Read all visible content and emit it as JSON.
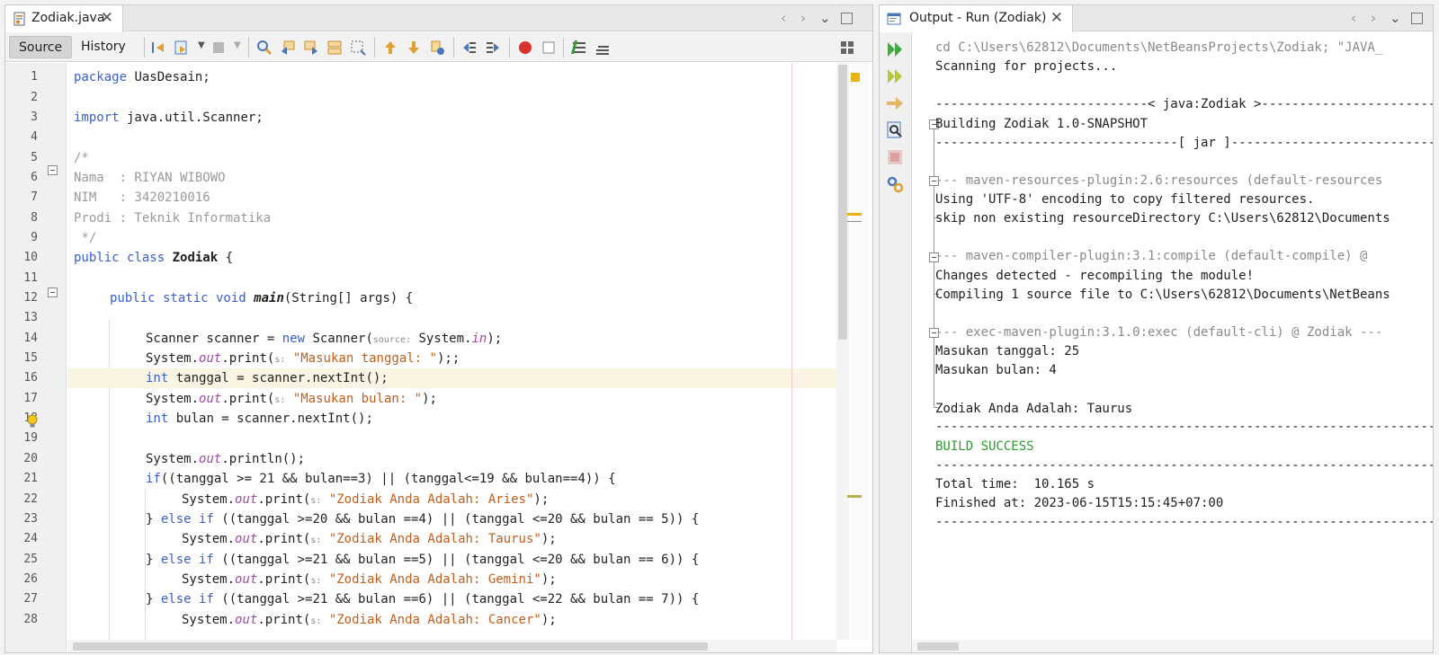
{
  "editor": {
    "tab_title": "Zodiak.java",
    "tab_close": "✕",
    "toolbar": {
      "source_label": "Source",
      "history_label": "History"
    },
    "line_numbers": [
      "1",
      "2",
      "3",
      "4",
      "5",
      "6",
      "7",
      "8",
      "9",
      "10",
      "11",
      "12",
      "13",
      "14",
      "15",
      "16",
      "17",
      "18",
      "19",
      "20",
      "21",
      "22",
      "23",
      "24",
      "25",
      "26",
      "27",
      "28"
    ],
    "code": {
      "l1_kw": "package",
      "l1_rest": " UasDesain;",
      "l3_kw": "import",
      "l3_rest": " java.util.Scanner;",
      "l5": "/*",
      "l6": "Nama  : RIYAN WIBOWO",
      "l7": "NIM   : 3420210016",
      "l8": "Prodi : Teknik Informatika",
      "l9": " */",
      "l10_kw": "public class",
      "l10_name": "Zodiak",
      "l10_rest": " {",
      "l12_kw": "public static void",
      "l12_name": "main",
      "l12_rest": "(String[] args) {",
      "l14_a": "Scanner scanner = ",
      "l14_kw": "new",
      "l14_b": " Scanner(",
      "l14_hint": "source:",
      "l14_c": " System.",
      "l14_fld": "in",
      "l14_d": ");",
      "l15_a": "System.",
      "l15_fld": "out",
      "l15_b": ".print(",
      "l15_hint": "s:",
      "l15_str": "\"Masukan tanggal: \"",
      "l15_c": ");;",
      "l16_kw": "int",
      "l16_rest": " tanggal = scanner.nextInt();",
      "l17_a": "System.",
      "l17_fld": "out",
      "l17_b": ".print(",
      "l17_hint": "s:",
      "l17_str": "\"Masukan bulan: \"",
      "l17_c": ");",
      "l18_kw": "int",
      "l18_rest": " bulan = scanner.nextInt();",
      "l20_a": "System.",
      "l20_fld": "out",
      "l20_b": ".println();",
      "l21_kw": "if",
      "l21_rest": "((tanggal >= 21 && bulan==3) || (tanggal<=19 && bulan==4)) {",
      "l22_a": "System.",
      "l22_fld": "out",
      "l22_b": ".print(",
      "l22_hint": "s:",
      "l22_str": "\"Zodiak Anda Adalah: Aries\"",
      "l22_c": ");",
      "l23_a": "} ",
      "l23_kw": "else if",
      "l23_rest": " ((tanggal >=20 && bulan ==4) || (tanggal <=20 && bulan == 5)) {",
      "l24_a": "System.",
      "l24_fld": "out",
      "l24_b": ".print(",
      "l24_hint": "s:",
      "l24_str": "\"Zodiak Anda Adalah: Taurus\"",
      "l24_c": ");",
      "l25_a": "} ",
      "l25_kw": "else if",
      "l25_rest": " ((tanggal >=21 && bulan ==5) || (tanggal <=20 && bulan == 6)) {",
      "l26_a": "System.",
      "l26_fld": "out",
      "l26_b": ".print(",
      "l26_hint": "s:",
      "l26_str": "\"Zodiak Anda Adalah: Gemini\"",
      "l26_c": ");",
      "l27_a": "} ",
      "l27_kw": "else if",
      "l27_rest": " ((tanggal >=21 && bulan ==6) || (tanggal <=22 && bulan == 7)) {",
      "l28_a": "System.",
      "l28_fld": "out",
      "l28_b": ".print(",
      "l28_hint": "s:",
      "l28_str": "\"Zodiak Anda Adalah: Cancer\"",
      "l28_c": ");"
    }
  },
  "output": {
    "tab_title": "Output - Run (Zodiak)",
    "tab_close": "✕",
    "lines": {
      "cmd": "cd C:\\Users\\62812\\Documents\\NetBeansProjects\\Zodiak; \"JAVA_",
      "scanning": "Scanning for projects...",
      "sep_java": "----------------------------< java:Zodiak >--------------------------",
      "building": "Building Zodiak 1.0-SNAPSHOT",
      "sep_jar": "--------------------------------[ jar ]-----------------------------",
      "resources": "--- maven-resources-plugin:2.6:resources (default-resources",
      "utf8": "Using 'UTF-8' encoding to copy filtered resources.",
      "skip": "skip non existing resourceDirectory C:\\Users\\62812\\Documents",
      "compiler": "--- maven-compiler-plugin:3.1:compile (default-compile) @",
      "changes": "Changes detected - recompiling the module!",
      "compiling": "Compiling 1 source file to C:\\Users\\62812\\Documents\\NetBeans",
      "exec": "--- exec-maven-plugin:3.1.0:exec (default-cli) @ Zodiak ---",
      "in_tanggal": "Masukan tanggal: 25",
      "in_bulan": "Masukan bulan: 4",
      "result": "Zodiak Anda Adalah: Taurus",
      "sep1": "------------------------------------------------------------------------",
      "build_success": "BUILD SUCCESS",
      "sep2": "------------------------------------------------------------------------",
      "total_time": "Total time:  10.165 s",
      "finished": "Finished at: 2023-06-15T15:15:45+07:00",
      "sep3": "------------------------------------------------------------------------"
    }
  },
  "colors": {
    "keyword": "#3a5ecb",
    "comment": "#9a9a9a",
    "string": "#c05e1e",
    "field": "#a348a3",
    "success": "#2e9b2e",
    "highlight": "#faf5e2"
  },
  "icons": [
    "java-file-icon",
    "back-icon",
    "forward-icon",
    "search-icon",
    "find-prev-icon",
    "find-next-icon",
    "toggle-highlight-icon",
    "select-icon",
    "bookmark-prev-icon",
    "bookmark-next-icon",
    "bookmark-toggle-icon",
    "shift-left-icon",
    "shift-right-icon",
    "record-macro-icon",
    "stop-macro-icon",
    "comment-icon",
    "uncomment-icon",
    "split-icon",
    "rerun-icon",
    "rerun-with-options-icon",
    "continue-icon",
    "inspect-icon",
    "stop-icon",
    "settings-icon",
    "lightbulb-icon"
  ]
}
